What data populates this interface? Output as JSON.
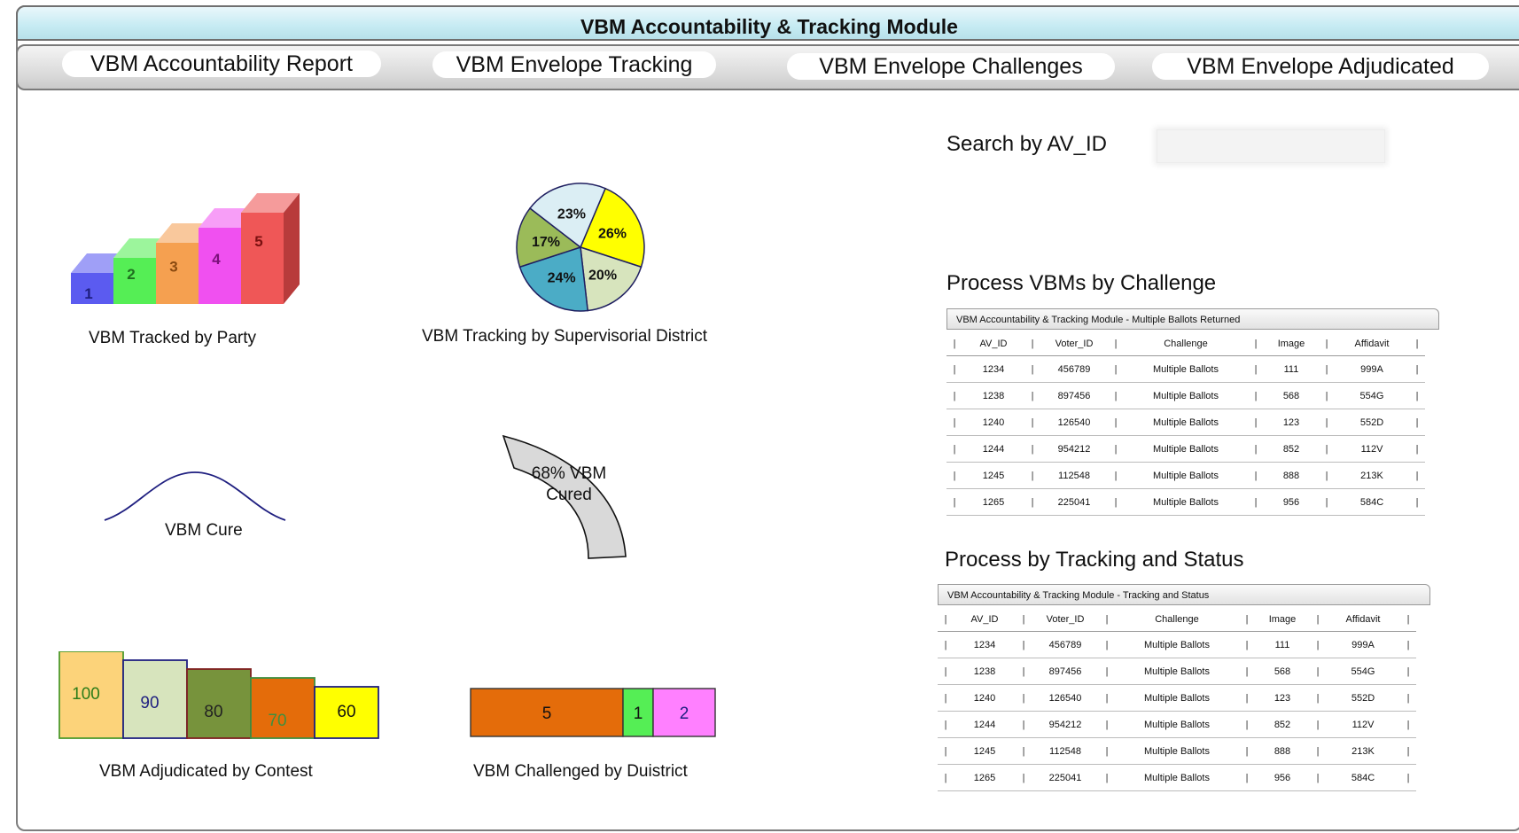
{
  "window": {
    "title": "VBM Accountability & Tracking Module"
  },
  "nav": {
    "items": [
      "VBM Accountability Report",
      "VBM Envelope Tracking",
      "VBM Envelope Challenges",
      "VBM Envelope Adjudicated"
    ]
  },
  "search": {
    "label": "Search by AV_ID",
    "value": ""
  },
  "charts": {
    "party": {
      "label": "VBM Tracked by Party"
    },
    "district": {
      "label": "VBM Tracking by Supervisorial District"
    },
    "cure": {
      "label": "VBM Cure"
    },
    "cured": {
      "label_line1": "68% VBM",
      "label_line2": "Cured"
    },
    "adjudicated": {
      "label": "VBM Adjudicated by Contest"
    },
    "challenged": {
      "label": "VBM Challenged by Duistrict"
    }
  },
  "chart_data": [
    {
      "type": "bar",
      "name_hint": "VBM Tracked by Party",
      "categories": [
        "1",
        "2",
        "3",
        "4",
        "5"
      ],
      "values": [
        1,
        2,
        3,
        4,
        5
      ],
      "colors": [
        "#5b5bf0",
        "#55ee55",
        "#f5a050",
        "#f050f0",
        "#ef5757"
      ]
    },
    {
      "type": "pie",
      "name_hint": "VBM Tracking by Supervisorial District",
      "slices": [
        {
          "label": "26%",
          "value": 26,
          "color": "#ffff00"
        },
        {
          "label": "20%",
          "value": 20,
          "color": "#d7e4bd"
        },
        {
          "label": "24%",
          "value": 24,
          "color": "#4bacc6"
        },
        {
          "label": "17%",
          "value": 17,
          "color": "#9bbb59"
        },
        {
          "label": "23%",
          "value": 23,
          "color": "#dbeef4"
        }
      ]
    },
    {
      "type": "bar",
      "name_hint": "VBM Adjudicated by Contest",
      "values": [
        100,
        90,
        80,
        70,
        60
      ],
      "labels": [
        "100",
        "90",
        "80",
        "70",
        "60"
      ],
      "fills": [
        "#fcd37a",
        "#d7e4bd",
        "#77933c",
        "#e46c0a",
        "#ffff00"
      ],
      "strokes": [
        "#4f9a2e",
        "#1f1f80",
        "#7f1f1f",
        "#3f8f3f",
        "#1f1f80"
      ],
      "text_colors": [
        "#2e7d1a",
        "#1f1f80",
        "#222222",
        "#3f8f3f",
        "#111111"
      ]
    },
    {
      "type": "bar",
      "name_hint": "VBM Challenged by Duistrict",
      "orientation": "stacked-horizontal",
      "values": [
        5,
        1,
        2
      ],
      "labels": [
        "5",
        "1",
        "2"
      ],
      "fills": [
        "#e46c0a",
        "#55ee55",
        "#ff80ff"
      ]
    }
  ],
  "gauge": {
    "value_pct": 68
  },
  "tables": {
    "challenge": {
      "header": "Process VBMs by Challenge",
      "title": "VBM Accountability & Tracking Module  - Multiple Ballots Returned",
      "columns": [
        "AV_ID",
        "Voter_ID",
        "Challenge",
        "Image",
        "Affidavit"
      ],
      "rows": [
        [
          "1234",
          "456789",
          "Multiple Ballots",
          "111",
          "999A"
        ],
        [
          "1238",
          "897456",
          "Multiple Ballots",
          "568",
          "554G"
        ],
        [
          "1240",
          "126540",
          "Multiple Ballots",
          "123",
          "552D"
        ],
        [
          "1244",
          "954212",
          "Multiple Ballots",
          "852",
          "112V"
        ],
        [
          "1245",
          "112548",
          "Multiple Ballots",
          "888",
          "213K"
        ],
        [
          "1265",
          "225041",
          "Multiple Ballots",
          "956",
          "584C"
        ]
      ]
    },
    "tracking": {
      "header": "Process by Tracking and Status",
      "title": "VBM Accountability & Tracking Module  - Tracking and Status",
      "columns": [
        "AV_ID",
        "Voter_ID",
        "Challenge",
        "Image",
        "Affidavit"
      ],
      "rows": [
        [
          "1234",
          "456789",
          "Multiple Ballots",
          "111",
          "999A"
        ],
        [
          "1238",
          "897456",
          "Multiple Ballots",
          "568",
          "554G"
        ],
        [
          "1240",
          "126540",
          "Multiple Ballots",
          "123",
          "552D"
        ],
        [
          "1244",
          "954212",
          "Multiple Ballots",
          "852",
          "112V"
        ],
        [
          "1245",
          "112548",
          "Multiple Ballots",
          "888",
          "213K"
        ],
        [
          "1265",
          "225041",
          "Multiple Ballots",
          "956",
          "584C"
        ]
      ]
    }
  }
}
